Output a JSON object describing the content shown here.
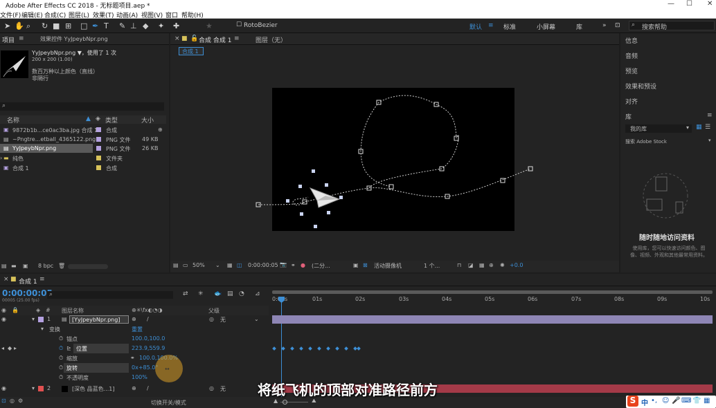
{
  "title": "Adobe After Effects CC 2018 - 无标题项目.aep *",
  "menu": [
    "文件(F)",
    "编辑(E)",
    "合成(C)",
    "图层(L)",
    "效果(T)",
    "动画(A)",
    "视图(V)",
    "窗口",
    "帮助(H)"
  ],
  "toolbar": {
    "rotobezier": "RotoBezier",
    "workspaces": [
      "默认",
      "标准",
      "小屏幕",
      "库"
    ],
    "search_placeholder": "搜索帮助"
  },
  "project": {
    "tab": "项目",
    "effect_tab": "效果控件 YyJpeybNpr.png",
    "asset_name": "YyJpeybNpr.png ▼，使用了 1 次",
    "asset_size": "200 x 200 (1.00)",
    "asset_color": "数百万种以上颜色（直线）",
    "asset_interlace": "非隔行",
    "col_name": "名称",
    "col_type": "类型",
    "col_size": "大小",
    "items": [
      {
        "name": "9872b1b...ce0ac3ba.jpg 合成 1",
        "type": "合成",
        "size": "",
        "color": "#b4a1e0"
      },
      {
        "name": "~Pngtre...etball_4365122.png",
        "type": "PNG 文件",
        "size": "49 KB",
        "color": "#b4a1e0"
      },
      {
        "name": "YyJpeybNpr.png",
        "type": "PNG 文件",
        "size": "26 KB",
        "color": "#b4a1e0"
      },
      {
        "name": "纯色",
        "type": "文件夹",
        "size": "",
        "color": "#d7c25a"
      },
      {
        "name": "合成 1",
        "type": "合成",
        "size": "",
        "color": "#d7c25a"
      }
    ],
    "bpc": "8 bpc"
  },
  "comp": {
    "tab": "合成 合成 1",
    "layer_tab": "图层（无）",
    "breadcrumb": "合成 1",
    "zoom": "50%",
    "timecode": "0:00:00:05",
    "resolution": "(二分...",
    "camera": "活动摄像机",
    "views": "1 个...",
    "exposure": "+0.0"
  },
  "right": {
    "items": [
      "信息",
      "音频",
      "预览",
      "效果和预设",
      "对齐"
    ],
    "library": "库",
    "mylib": "我的库",
    "stock": "搜索 Adobe Stock",
    "promo_title": "随时随地访问资料",
    "promo_text": "使用库，您可以快速访问颜色、图像、视频、外观和其他最常用资料。"
  },
  "timeline": {
    "tab": "合成 1",
    "timecode": "0:00:00:05",
    "fps": "00005 (25.00 fps)",
    "col_layer": "图层名称",
    "col_parent": "父级",
    "ticks": [
      "0:00s",
      "01s",
      "02s",
      "03s",
      "04s",
      "05s",
      "06s",
      "07s",
      "08s",
      "09s",
      "10s"
    ],
    "layer1": {
      "num": "1",
      "name": "[YyJpeybNpr.png]",
      "parent": "无"
    },
    "transform": "变换",
    "reset": "重置",
    "props": [
      {
        "name": "锚点",
        "value": "100.0,100.0"
      },
      {
        "name": "位置",
        "value": "223.9,559.9"
      },
      {
        "name": "缩放",
        "value": "100.0,100.0%"
      },
      {
        "name": "旋转",
        "value": "0x+85.0°"
      },
      {
        "name": "不透明度",
        "value": "100%"
      }
    ],
    "layer2": {
      "num": "2",
      "name": "[深色 品蓝色...1]",
      "parent": "无"
    },
    "footer": "切换开关/模式"
  },
  "subtitle": "将纸飞机的顶部对准路径前方",
  "ime": "中"
}
